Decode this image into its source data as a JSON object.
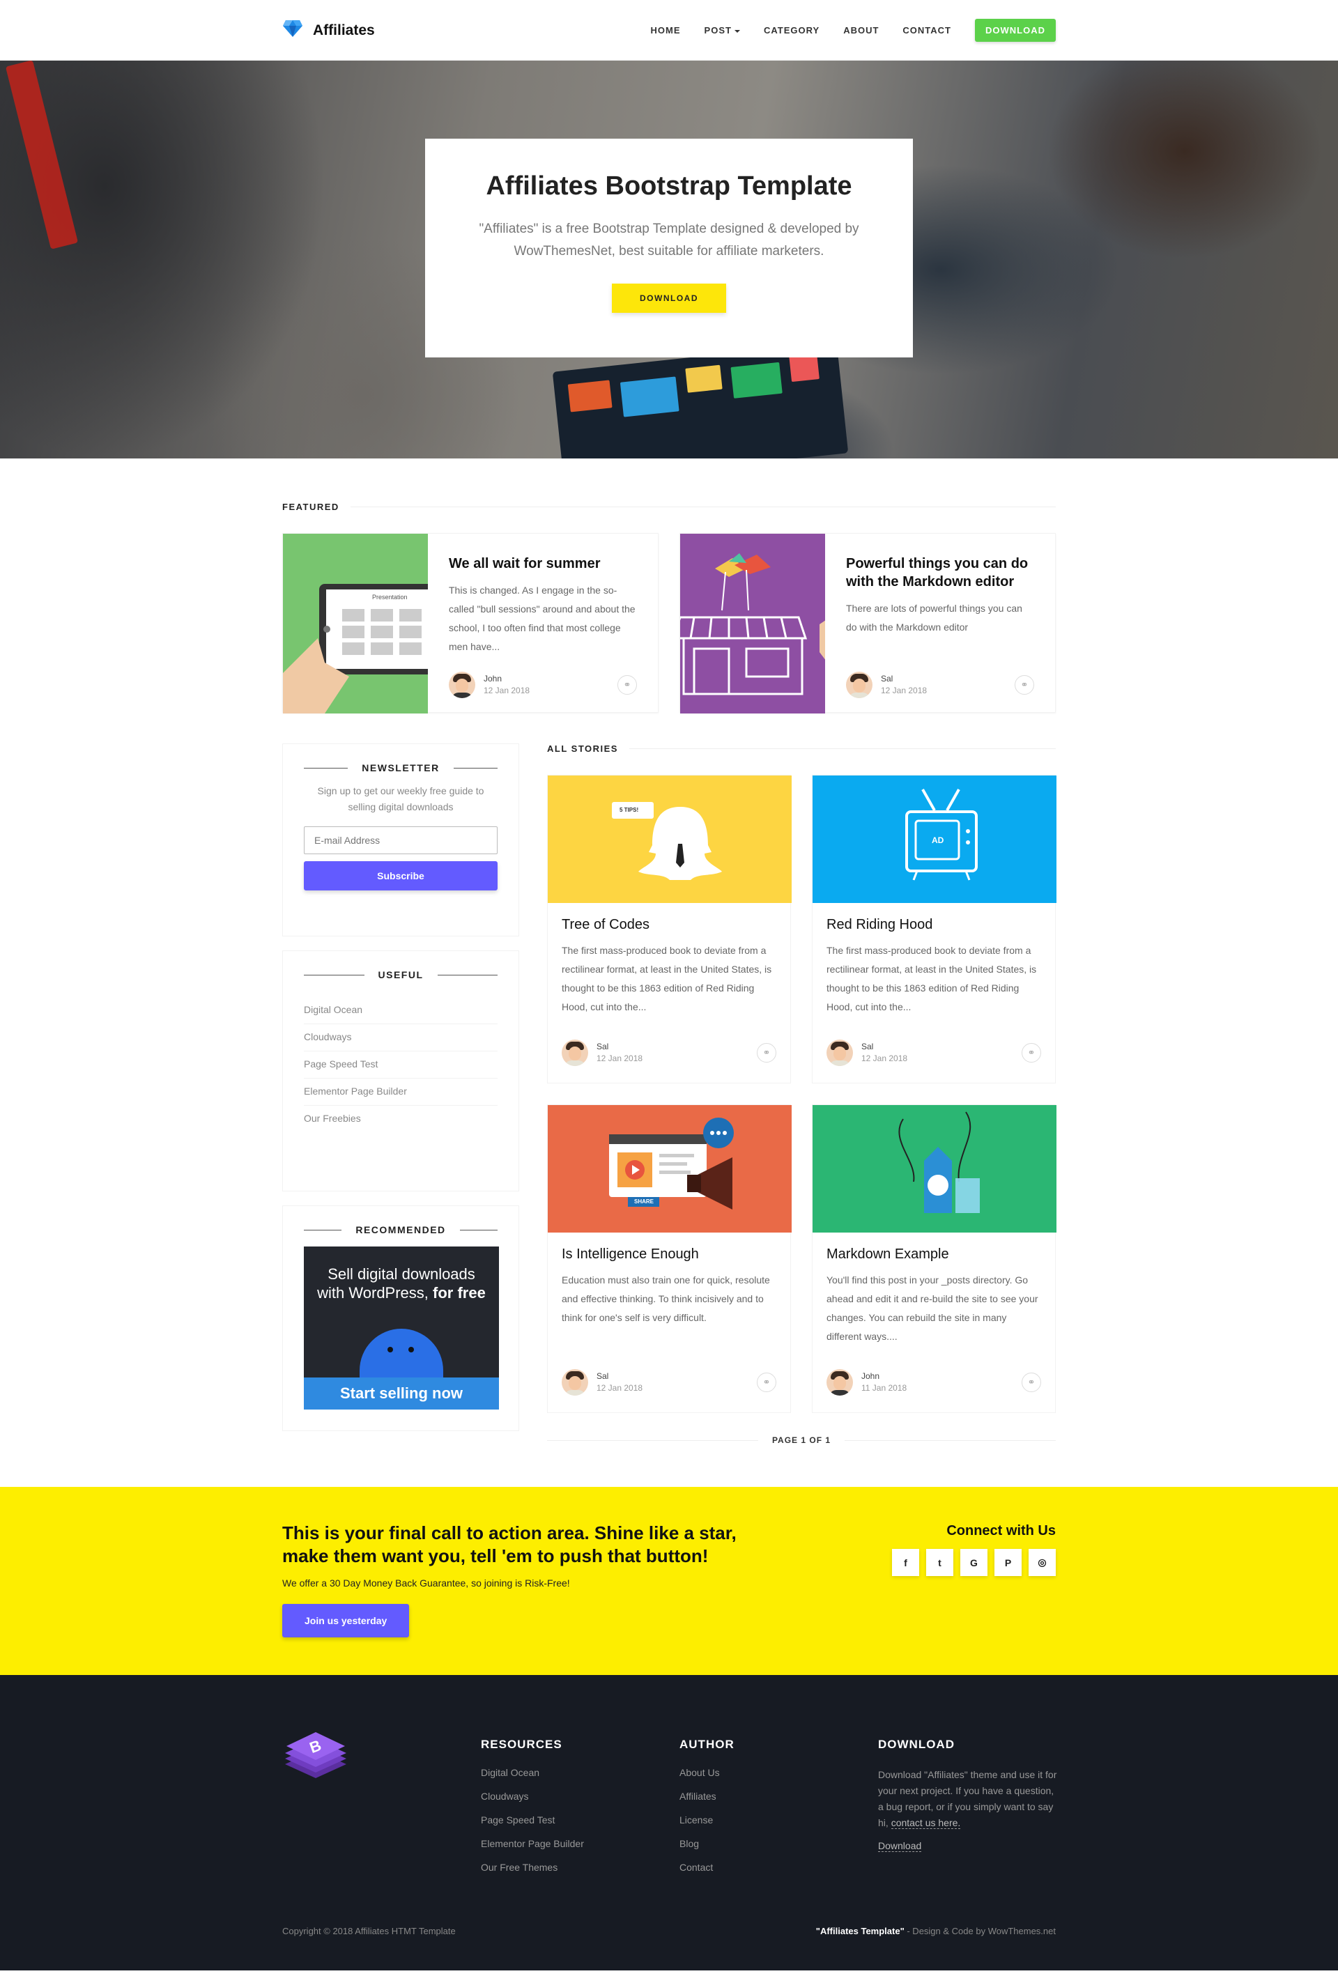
{
  "nav": {
    "brand": "Affiliates",
    "links": [
      "HOME",
      "POST",
      "CATEGORY",
      "ABOUT",
      "CONTACT"
    ],
    "download": "DOWNLOAD"
  },
  "hero": {
    "title": "Affiliates Bootstrap Template",
    "description": "\"Affiliates\" is a free Bootstrap Template designed & developed by WowThemesNet, best suitable for affiliate marketers.",
    "button": "DOWNLOAD"
  },
  "featured": {
    "title": "FEATURED",
    "posts": [
      {
        "title": "We all wait for summer",
        "excerpt": "This is changed. As I engage in the so-called \"bull sessions\" around and about the school, I too often find that most college men have...",
        "author": "John",
        "date": "12 Jan 2018",
        "image_text": "Presentation"
      },
      {
        "title": "Powerful things you can do with the Markdown editor",
        "excerpt": "There are lots of powerful things you can do with the Markdown editor",
        "author": "Sal",
        "date": "12 Jan 2018"
      }
    ]
  },
  "sidebar": {
    "newsletter": {
      "title": "NEWSLETTER",
      "text": "Sign up to get our weekly free guide to selling digital downloads",
      "placeholder": "E-mail Address",
      "button": "Subscribe"
    },
    "useful": {
      "title": "USEFUL",
      "items": [
        "Digital Ocean",
        "Cloudways",
        "Page Speed Test",
        "Elementor Page Builder",
        "Our Freebies"
      ]
    },
    "recommended": {
      "title": "RECOMMENDED",
      "ad_line1": "Sell digital downloads with WordPress,",
      "ad_bold": "for free",
      "ad_cta": "Start selling now"
    }
  },
  "stories": {
    "title": "ALL STORIES",
    "posts": [
      {
        "title": "Tree of Codes",
        "excerpt": "The first mass-produced book to deviate from a rectilinear format, at least in the United States, is thought to be this 1863 edition of Red Riding Hood, cut into the...",
        "author": "Sal",
        "date": "12 Jan 2018",
        "image_text": "5 TIPS!"
      },
      {
        "title": "Red Riding Hood",
        "excerpt": "The first mass-produced book to deviate from a rectilinear format, at least in the United States, is thought to be this 1863 edition of Red Riding Hood, cut into the...",
        "author": "Sal",
        "date": "12 Jan 2018",
        "image_text": "AD"
      },
      {
        "title": "Is Intelligence Enough",
        "excerpt": "Education must also train one for quick, resolute and effective thinking. To think incisively and to think for one's self is very difficult.",
        "author": "Sal",
        "date": "12 Jan 2018",
        "image_text": "SHARE"
      },
      {
        "title": "Markdown Example",
        "excerpt": "You'll find this post in your _posts directory. Go ahead and edit it and re-build the site to see your changes. You can rebuild the site in many different ways....",
        "author": "John",
        "date": "11 Jan 2018"
      }
    ],
    "pagination": "PAGE 1 OF 1"
  },
  "cta": {
    "title": "This is your final call to action area. Shine like a star, make them want you, tell 'em to push that button!",
    "subtitle": "We offer a 30 Day Money Back Guarantee, so joining is Risk-Free!",
    "button": "Join us yesterday",
    "connect_title": "Connect with Us",
    "socials": [
      {
        "icon": "facebook-icon",
        "glyph": "f"
      },
      {
        "icon": "twitter-icon",
        "glyph": "t"
      },
      {
        "icon": "google-icon",
        "glyph": "G"
      },
      {
        "icon": "pinterest-icon",
        "glyph": "P"
      },
      {
        "icon": "github-icon",
        "glyph": "◎"
      }
    ]
  },
  "footer": {
    "resources": {
      "title": "RESOURCES",
      "items": [
        "Digital Ocean",
        "Cloudways",
        "Page Speed Test",
        "Elementor Page Builder",
        "Our Free Themes"
      ]
    },
    "author": {
      "title": "AUTHOR",
      "items": [
        "About Us",
        "Affiliates",
        "License",
        "Blog",
        "Contact"
      ]
    },
    "download": {
      "title": "DOWNLOAD",
      "text": "Download \"Affiliates\" theme and use it for your next project. If you have a question, a bug report, or if you simply want to say hi,",
      "contact_link": "contact us here.",
      "download_link": "Download"
    },
    "copyright": "Copyright © 2018 Affiliates HTMT Template",
    "credit_bold": "\"Affiliates Template\"",
    "credit_rest": " - Design & Code by WowThemes.net"
  },
  "colors": {
    "accent": "#635bff",
    "yellow": "#fdee00",
    "green_button": "#5cd14a",
    "footer_bg": "#171b23"
  }
}
